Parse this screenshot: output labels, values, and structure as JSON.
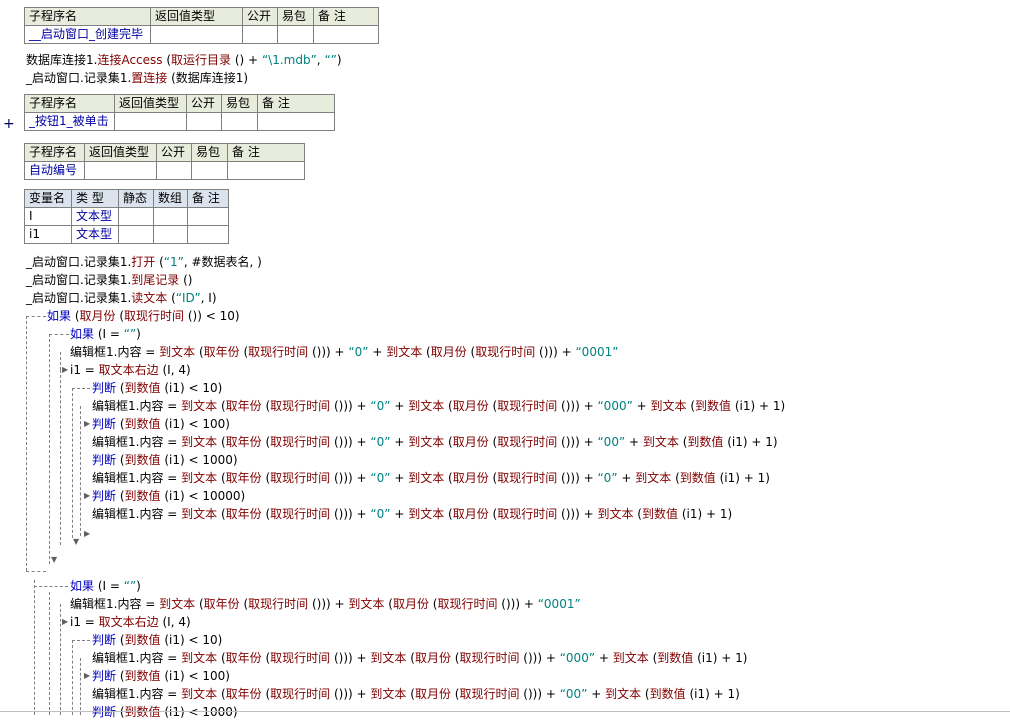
{
  "sub_header": {
    "name": "子程序名",
    "ret": "返回值类型",
    "pub": "公开",
    "easy": "易包",
    "note": "备 注"
  },
  "var_header": {
    "name": "变量名",
    "type": "类 型",
    "static": "静态",
    "array": "数组",
    "note": "备 注"
  },
  "sub1": {
    "name": "__启动窗口_创建完毕"
  },
  "sub2": {
    "name": "_按钮1_被单击",
    "expander": "+"
  },
  "sub3": {
    "name": "自动编号"
  },
  "vars": [
    {
      "name": "I",
      "type": "文本型"
    },
    {
      "name": "i1",
      "type": "文本型"
    }
  ],
  "code": {
    "l1": [
      "数据库连接1.",
      "连接Access",
      " (",
      "取运行目录",
      " () + ",
      "“\\1.mdb”",
      ", ",
      "“”",
      ")"
    ],
    "l2": [
      "_启动窗口.记录集1.",
      "置连接",
      " (数据库连接1)"
    ],
    "l3": [
      "_启动窗口.记录集1.",
      "打开",
      " (",
      "“1”",
      ", #数据表名, )"
    ],
    "l4": [
      "_启动窗口.记录集1.",
      "到尾记录",
      " ()"
    ],
    "l5": [
      "_启动窗口.记录集1.",
      "读文本",
      " (",
      "“ID”",
      ", I)"
    ],
    "l6": [
      "如果",
      " (",
      "取月份",
      " (",
      "取现行时间",
      " ()) < 10)"
    ],
    "l7": [
      "如果",
      " (I = ",
      "“”",
      ")"
    ],
    "l8": [
      "编辑框1.内容 = ",
      "到文本",
      " (",
      "取年份",
      " (",
      "取现行时间",
      " ())) + ",
      "“0”",
      " + ",
      "到文本",
      " (",
      "取月份",
      " (",
      "取现行时间",
      " ())) + ",
      "“0001”"
    ],
    "l9": [
      "i1 = ",
      "取文本右边",
      " (I, 4)"
    ],
    "l10": [
      "判断",
      " (",
      "到数值",
      " (i1) < 10)"
    ],
    "l11": [
      "编辑框1.内容 = ",
      "到文本",
      " (",
      "取年份",
      " (",
      "取现行时间",
      " ())) + ",
      "“0”",
      " + ",
      "到文本",
      " (",
      "取月份",
      " (",
      "取现行时间",
      " ())) + ",
      "“000”",
      " + ",
      "到文本",
      " (",
      "到数值",
      " (i1) + 1)"
    ],
    "l12": [
      "判断",
      " (",
      "到数值",
      " (i1) < 100)"
    ],
    "l13": [
      "编辑框1.内容 = ",
      "到文本",
      " (",
      "取年份",
      " (",
      "取现行时间",
      " ())) + ",
      "“0”",
      " + ",
      "到文本",
      " (",
      "取月份",
      " (",
      "取现行时间",
      " ())) + ",
      "“00”",
      " + ",
      "到文本",
      " (",
      "到数值",
      " (i1) + 1)"
    ],
    "l14": [
      "判断",
      " (",
      "到数值",
      " (i1) < 1000)"
    ],
    "l15": [
      "编辑框1.内容 = ",
      "到文本",
      " (",
      "取年份",
      " (",
      "取现行时间",
      " ())) + ",
      "“0”",
      " + ",
      "到文本",
      " (",
      "取月份",
      " (",
      "取现行时间",
      " ())) + ",
      "“0”",
      " + ",
      "到文本",
      " (",
      "到数值",
      " (i1) + 1)"
    ],
    "l16": [
      "判断",
      " (",
      "到数值",
      " (i1) < 10000)"
    ],
    "l17": [
      "编辑框1.内容 = ",
      "到文本",
      " (",
      "取年份",
      " (",
      "取现行时间",
      " ())) + ",
      "“0”",
      " + ",
      "到文本",
      " (",
      "取月份",
      " (",
      "取现行时间",
      " ())) + ",
      "到文本",
      " (",
      "到数值",
      " (i1) + 1)"
    ],
    "l18": [
      "如果",
      " (I = ",
      "“”",
      ")"
    ],
    "l19": [
      "编辑框1.内容 = ",
      "到文本",
      " (",
      "取年份",
      " (",
      "取现行时间",
      " ())) + ",
      "到文本",
      " (",
      "取月份",
      " (",
      "取现行时间",
      " ())) + ",
      "“0001”"
    ],
    "l20": [
      "i1 = ",
      "取文本右边",
      " (I, 4)"
    ],
    "l21": [
      "判断",
      " (",
      "到数值",
      " (i1) < 10)"
    ],
    "l22": [
      "编辑框1.内容 = ",
      "到文本",
      " (",
      "取年份",
      " (",
      "取现行时间",
      " ())) + ",
      "到文本",
      " (",
      "取月份",
      " (",
      "取现行时间",
      " ())) + ",
      "“000”",
      " + ",
      "到文本",
      " (",
      "到数值",
      " (i1) + 1)"
    ],
    "l23": [
      "判断",
      " (",
      "到数值",
      " (i1) < 100)"
    ],
    "l24": [
      "编辑框1.内容 = ",
      "到文本",
      " (",
      "取年份",
      " (",
      "取现行时间",
      " ())) + ",
      "到文本",
      " (",
      "取月份",
      " (",
      "取现行时间",
      " ())) + ",
      "“00”",
      " + ",
      "到文本",
      " (",
      "到数值",
      " (i1) + 1)"
    ],
    "l25": [
      "判断",
      " (",
      "到数值",
      " (i1) < 1000)"
    ]
  },
  "colors": {
    "keyword": "#0000c0",
    "function": "#800000",
    "string": "#008080",
    "header_bg": "#e8ecdc",
    "var_header_bg": "#dbe4ee",
    "guide": "#808080"
  }
}
